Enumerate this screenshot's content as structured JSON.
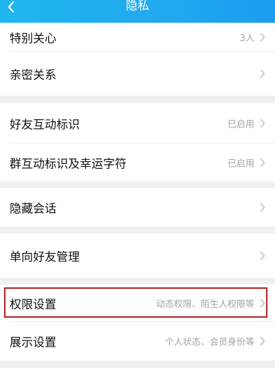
{
  "header": {
    "title": "隐私",
    "back_icon": "chevron-left-icon",
    "background": "#22a8f0"
  },
  "items": [
    {
      "label": "特别关心",
      "value": "3人"
    },
    {
      "label": "亲密关系",
      "value": ""
    },
    {
      "label": "好友互动标识",
      "value": "已启用"
    },
    {
      "label": "群互动标识及幸运字符",
      "value": "已启用"
    },
    {
      "label": "隐藏会话",
      "value": ""
    },
    {
      "label": "单向好友管理",
      "value": ""
    },
    {
      "label": "权限设置",
      "value": "动态权限、陌生人权限等"
    },
    {
      "label": "展示设置",
      "value": "个人状态、会员身份等"
    }
  ],
  "highlight_color": "#b41e1e",
  "chevron_icon": "chevron-right-icon"
}
